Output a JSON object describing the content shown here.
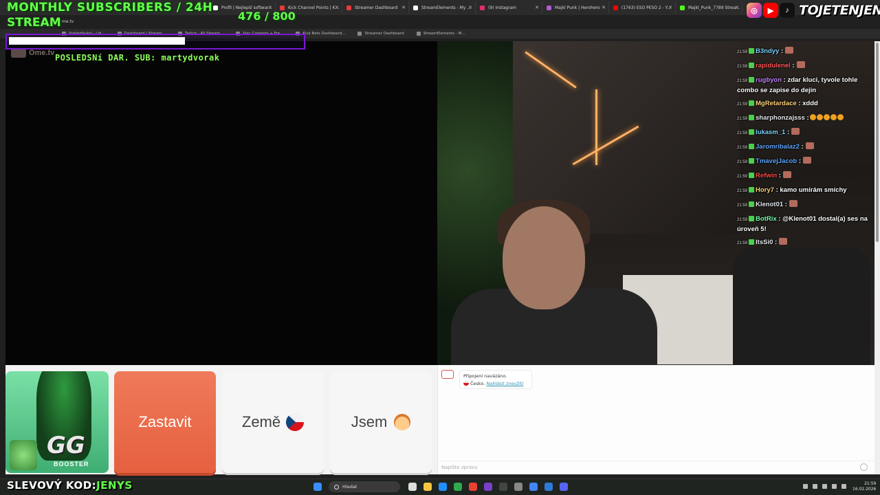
{
  "browser": {
    "tabs": [
      {
        "label": "ent",
        "color": "#7a7a7a"
      },
      {
        "label": "Profil | Nejlepší softwar...",
        "color": "#ffffff"
      },
      {
        "label": "Kick Channel Points | K...",
        "color": "#e83a3a"
      },
      {
        "label": "Streamer Dashboard",
        "color": "#e83a3a"
      },
      {
        "label": "StreamElements - My ...",
        "color": "#ffffff"
      },
      {
        "label": "(9) Instagram",
        "color": "#e1306c"
      },
      {
        "label": "Majkl Punk | Herohero",
        "color": "#b05ad6"
      },
      {
        "label": "(1763) ESO PESO 2 - Y...",
        "color": "#ff0000"
      },
      {
        "label": "Majkl_Punk_7789 Strea...",
        "color": "#53fc18"
      }
    ],
    "url": "me.tv",
    "bookmarks": [
      "Vyhledávání - Lid...",
      "Dashboard | Stream...",
      "Twitch - All Stream...",
      "Viac Contests + Fre...",
      "Kick Bets Dashboard...",
      "Streamer Dashboard",
      "StreamElements - M..."
    ]
  },
  "overlay": {
    "title": "MONTHLY SUBSCRIBERS / 24H",
    "stream": "STREAM",
    "count": "476  / 800",
    "progress": 0.595,
    "last_donation": "POSLEDSNí DAR. SUB: martydvorak",
    "ome_logo": "Ome.tv",
    "handle": "TOJETENJENS",
    "promo_label": "SLEVOVÝ KOD:",
    "promo_code": "JENYS"
  },
  "chat": [
    {
      "time": "21:59",
      "user": "B3ndyy",
      "color": "#7dd3fc",
      "text": ":",
      "emote": true
    },
    {
      "time": "21:59",
      "user": "rapidulenel",
      "color": "#ff5a5a",
      "text": ":",
      "emote": true
    },
    {
      "time": "21:59",
      "user": "rugbyon",
      "color": "#c084fc",
      "text": ": zdar kluci, tyvole tohle combo se zapise do dejin",
      "emote": false
    },
    {
      "time": "21:59",
      "user": "MgRetardace",
      "color": "#ffd27a",
      "text": ": xddd",
      "emote": false
    },
    {
      "time": "21:59",
      "user": "sharphonzajsss",
      "color": "#e5e7eb",
      "text": ":",
      "emote": false,
      "emojis": 5
    },
    {
      "time": "21:59",
      "user": "lukasm_1",
      "color": "#7dd3fc",
      "text": ":",
      "emote": true
    },
    {
      "time": "21:59",
      "user": "Jaromribalaz2",
      "color": "#60a5fa",
      "text": ":",
      "emote": true
    },
    {
      "time": "21:59",
      "user": "TmavejJacob",
      "color": "#60a5fa",
      "text": ":",
      "emote": true
    },
    {
      "time": "21:59",
      "user": "Refwin",
      "color": "#ff4a4a",
      "text": ":",
      "emote": true
    },
    {
      "time": "21:59",
      "user": "Hory7",
      "color": "#ffd27a",
      "text": ": kamo umírám smíchy",
      "emote": false
    },
    {
      "time": "21:59",
      "user": "Klenot01",
      "color": "#e5e7eb",
      "text": ":",
      "emote": true
    },
    {
      "time": "21:59",
      "user": "BotRix",
      "color": "#7dffb0",
      "text": ": @Klenot01 dostal(a) ses na úroveň 5!",
      "emote": false
    },
    {
      "time": "21:59",
      "user": "ItsSi0",
      "color": "#e5e7eb",
      "text": ":",
      "emote": true
    }
  ],
  "controls": {
    "stop_label": "Zastavit",
    "country_label": "Země",
    "gender_label": "Jsem"
  },
  "chatpanel": {
    "connected": "Připojení navázáno.",
    "country": "Česko.",
    "report": "Nahlásit zneužití",
    "input_placeholder": "Napište zprávu"
  },
  "mascot": {
    "gg": "GG",
    "booster": "BOOSTER"
  },
  "taskbar": {
    "search": "Hledat",
    "time": "21:59",
    "date": "16.02.2026"
  },
  "colors": {
    "accent_green": "#63ff4a",
    "stop_orange": "#e9684a",
    "progress_border": "#7a18d8"
  }
}
